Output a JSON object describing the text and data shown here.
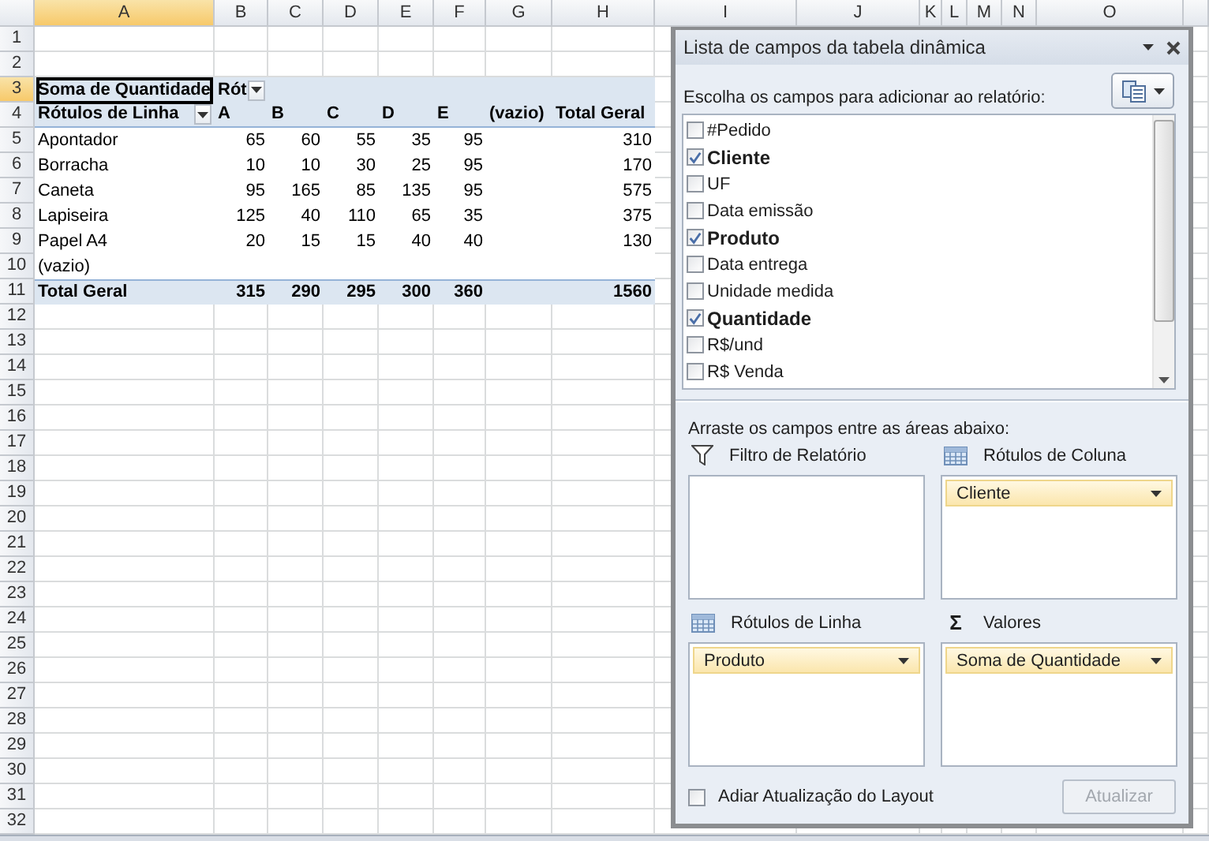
{
  "sheet": {
    "columns": [
      {
        "label": "A",
        "selected": true
      },
      {
        "label": "B",
        "selected": false
      },
      {
        "label": "C",
        "selected": false
      },
      {
        "label": "D",
        "selected": false
      },
      {
        "label": "E",
        "selected": false
      },
      {
        "label": "F",
        "selected": false
      },
      {
        "label": "G",
        "selected": false
      },
      {
        "label": "H",
        "selected": false
      },
      {
        "label": "I",
        "selected": false
      },
      {
        "label": "J",
        "selected": false
      },
      {
        "label": "K",
        "selected": false
      },
      {
        "label": "L",
        "selected": false
      },
      {
        "label": "M",
        "selected": false
      },
      {
        "label": "N",
        "selected": false
      },
      {
        "label": "O",
        "selected": false
      }
    ],
    "rows": [
      {
        "number": "1",
        "selected": false,
        "kind": "blank"
      },
      {
        "number": "2",
        "selected": false,
        "kind": "blank"
      },
      {
        "number": "3",
        "selected": true,
        "kind": "filter",
        "cells": [
          {
            "text": "Soma de Quantidade",
            "active": true
          },
          {
            "text": "Rót",
            "dropdown": true
          }
        ]
      },
      {
        "number": "4",
        "selected": false,
        "kind": "header",
        "cells": [
          {
            "text": "Rótulos de Linha",
            "dropdown": true
          },
          "A",
          "B",
          "C",
          "D",
          "E",
          "(vazio)",
          "Total Geral"
        ]
      },
      {
        "number": "5",
        "selected": false,
        "kind": "data",
        "cells": [
          "Apontador",
          "65",
          "60",
          "55",
          "35",
          "95",
          "",
          "310"
        ]
      },
      {
        "number": "6",
        "selected": false,
        "kind": "data",
        "cells": [
          "Borracha",
          "10",
          "10",
          "30",
          "25",
          "95",
          "",
          "170"
        ]
      },
      {
        "number": "7",
        "selected": false,
        "kind": "data",
        "cells": [
          "Caneta",
          "95",
          "165",
          "85",
          "135",
          "95",
          "",
          "575"
        ]
      },
      {
        "number": "8",
        "selected": false,
        "kind": "data",
        "cells": [
          "Lapiseira",
          "125",
          "40",
          "110",
          "65",
          "35",
          "",
          "375"
        ]
      },
      {
        "number": "9",
        "selected": false,
        "kind": "data",
        "cells": [
          "Papel A4",
          "20",
          "15",
          "15",
          "40",
          "40",
          "",
          "130"
        ]
      },
      {
        "number": "10",
        "selected": false,
        "kind": "data",
        "cells": [
          "(vazio)"
        ]
      },
      {
        "number": "11",
        "selected": false,
        "kind": "total",
        "cells": [
          "Total Geral",
          "315",
          "290",
          "295",
          "300",
          "360",
          "",
          "1560"
        ]
      },
      {
        "number": "12",
        "selected": false,
        "kind": "blank"
      },
      {
        "number": "13",
        "selected": false,
        "kind": "blank"
      },
      {
        "number": "14",
        "selected": false,
        "kind": "blank"
      },
      {
        "number": "15",
        "selected": false,
        "kind": "blank"
      },
      {
        "number": "16",
        "selected": false,
        "kind": "blank"
      },
      {
        "number": "17",
        "selected": false,
        "kind": "blank"
      },
      {
        "number": "18",
        "selected": false,
        "kind": "blank"
      },
      {
        "number": "19",
        "selected": false,
        "kind": "blank"
      },
      {
        "number": "20",
        "selected": false,
        "kind": "blank"
      },
      {
        "number": "21",
        "selected": false,
        "kind": "blank"
      },
      {
        "number": "22",
        "selected": false,
        "kind": "blank"
      },
      {
        "number": "23",
        "selected": false,
        "kind": "blank"
      },
      {
        "number": "24",
        "selected": false,
        "kind": "blank"
      },
      {
        "number": "25",
        "selected": false,
        "kind": "blank"
      },
      {
        "number": "26",
        "selected": false,
        "kind": "blank"
      },
      {
        "number": "27",
        "selected": false,
        "kind": "blank"
      },
      {
        "number": "28",
        "selected": false,
        "kind": "blank"
      },
      {
        "number": "29",
        "selected": false,
        "kind": "blank"
      },
      {
        "number": "30",
        "selected": false,
        "kind": "blank"
      },
      {
        "number": "31",
        "selected": false,
        "kind": "blank"
      },
      {
        "number": "32",
        "selected": false,
        "kind": "blank"
      }
    ]
  },
  "field_list": {
    "title": "Lista de campos da tabela dinâmica",
    "instruction": "Escolha os campos para adicionar ao relatório:",
    "fields": [
      {
        "label": "#Pedido",
        "checked": false
      },
      {
        "label": "Cliente",
        "checked": true
      },
      {
        "label": "UF",
        "checked": false
      },
      {
        "label": "Data emissão",
        "checked": false
      },
      {
        "label": "Produto",
        "checked": true
      },
      {
        "label": "Data entrega",
        "checked": false
      },
      {
        "label": "Unidade medida",
        "checked": false
      },
      {
        "label": "Quantidade",
        "checked": true
      },
      {
        "label": "R$/und",
        "checked": false
      },
      {
        "label": "R$ Venda",
        "checked": false
      }
    ],
    "areas_instruction": "Arraste os campos entre as áreas abaixo:",
    "areas": [
      {
        "kind": "filter",
        "title": "Filtro de Relatório"
      },
      {
        "kind": "columns",
        "title": "Rótulos de Coluna",
        "items": [
          {
            "label": "Cliente"
          }
        ]
      },
      {
        "kind": "rows",
        "title": "Rótulos de Linha",
        "items": [
          {
            "label": "Produto"
          }
        ]
      },
      {
        "kind": "values",
        "title": "Valores",
        "icon_text": "Σ",
        "items": [
          {
            "label": "Soma de Quantidade"
          }
        ]
      }
    ],
    "defer": {
      "label": "Adiar Atualização do Layout",
      "checked": false
    },
    "update_button": {
      "label": "Atualizar",
      "disabled": true
    }
  }
}
